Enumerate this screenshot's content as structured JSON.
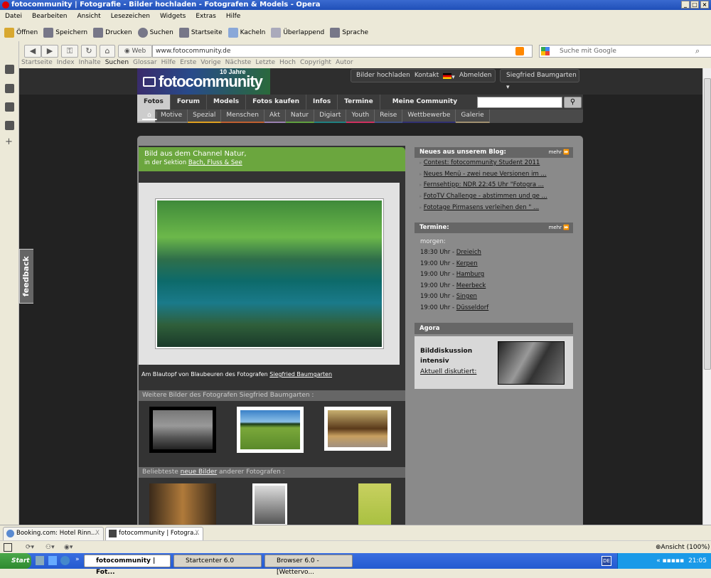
{
  "window": {
    "title": "fotocommunity | Fotografie - Bilder hochladen - Fotografen & Models - Opera"
  },
  "menu": [
    "Datei",
    "Bearbeiten",
    "Ansicht",
    "Lesezeichen",
    "Widgets",
    "Extras",
    "Hilfe"
  ],
  "toolbar": [
    "Öffnen",
    "Speichern",
    "Drucken",
    "Suchen",
    "Startseite",
    "Kacheln",
    "Überlappend",
    "Sprache"
  ],
  "address": {
    "web_label": "Web",
    "url": "www.fotocommunity.de",
    "search_placeholder": "Suche mit Google"
  },
  "links_bar": [
    "Startseite",
    "Index",
    "Inhalte",
    "Suchen",
    "Glossar",
    "Hilfe",
    "Erste",
    "Vorige",
    "Nächste",
    "Letzte",
    "Hoch",
    "Copyright",
    "Autor"
  ],
  "site": {
    "logo": "fotocommunity",
    "logo_badge": "10 Jahre",
    "top_links": [
      "Bilder hochladen",
      "Kontakt",
      "Abmelden"
    ],
    "user": "Siegfried Baumgarten",
    "main_nav": [
      "Fotos",
      "Forum",
      "Models",
      "Fotos kaufen",
      "Infos",
      "Termine",
      "Meine Community"
    ],
    "sub_nav": [
      {
        "label": "Motive",
        "color": "#777777"
      },
      {
        "label": "Spezial",
        "color": "#e0a020"
      },
      {
        "label": "Menschen",
        "color": "#c06030"
      },
      {
        "label": "Akt",
        "color": "#9a80b0"
      },
      {
        "label": "Natur",
        "color": "#60a040"
      },
      {
        "label": "Digiart",
        "color": "#208080"
      },
      {
        "label": "Youth",
        "color": "#d03060"
      },
      {
        "label": "Reise",
        "color": "#405080"
      },
      {
        "label": "Wettbewerbe",
        "color": "#303070"
      },
      {
        "label": "Galerie",
        "color": "#a09070"
      }
    ],
    "channel": {
      "title": "Bild aus dem Channel Natur,",
      "section_prefix": "in der Sektion",
      "section": "Bach, Fluss & See"
    },
    "caption": {
      "text": "Am Blautopf von Blaubeuren des Fotografen",
      "author": "Siegfried Baumgarten"
    },
    "more_by": "Weitere Bilder des Fotografen Siegfried Baumgarten :",
    "popular": {
      "prefix": "Beliebteste",
      "link": "neue Bilder",
      "suffix": "anderer Fotografen :"
    },
    "blog": {
      "title": "Neues aus unserem Blog:",
      "more": "mehr ⏩",
      "items": [
        "Contest: fotocommunity Student 2011",
        "Neues Menü - zwei neue Versionen im ...",
        "Fernsehtipp: NDR 22:45 Uhr \"Fotogra ...",
        "FotoTV Challenge - abstimmen und ge ...",
        "Fototage Pirmasens verleihen den \" ..."
      ]
    },
    "termine": {
      "title": "Termine:",
      "more": "mehr ⏩",
      "day": "morgen:",
      "items": [
        {
          "time": "18:30 Uhr -",
          "place": "Dreieich"
        },
        {
          "time": "19:00 Uhr -",
          "place": "Kerpen"
        },
        {
          "time": "19:00 Uhr -",
          "place": "Hamburg"
        },
        {
          "time": "19:00 Uhr -",
          "place": "Meerbeck"
        },
        {
          "time": "19:00 Uhr -",
          "place": "Singen"
        },
        {
          "time": "19:00 Uhr -",
          "place": "Düsseldorf"
        }
      ]
    },
    "agora": {
      "title": "Agora",
      "headline": "Bilddiskussion intensiv",
      "link": "Aktuell diskutiert:"
    },
    "feedback": "feedback"
  },
  "tabs": [
    {
      "label": "Booking.com: Hotel Rinn...",
      "close": "X"
    },
    {
      "label": "fotocommunity | Fotogra...",
      "close": "X"
    }
  ],
  "status": {
    "zoom": "Ansicht (100%)"
  },
  "taskbar": {
    "start": "Start",
    "tasks": [
      "fotocommunity | Fot...",
      "Startcenter 6.0",
      "Browser 6.0 - [Wettervo..."
    ],
    "lang": "DE",
    "clock": "21:05"
  }
}
